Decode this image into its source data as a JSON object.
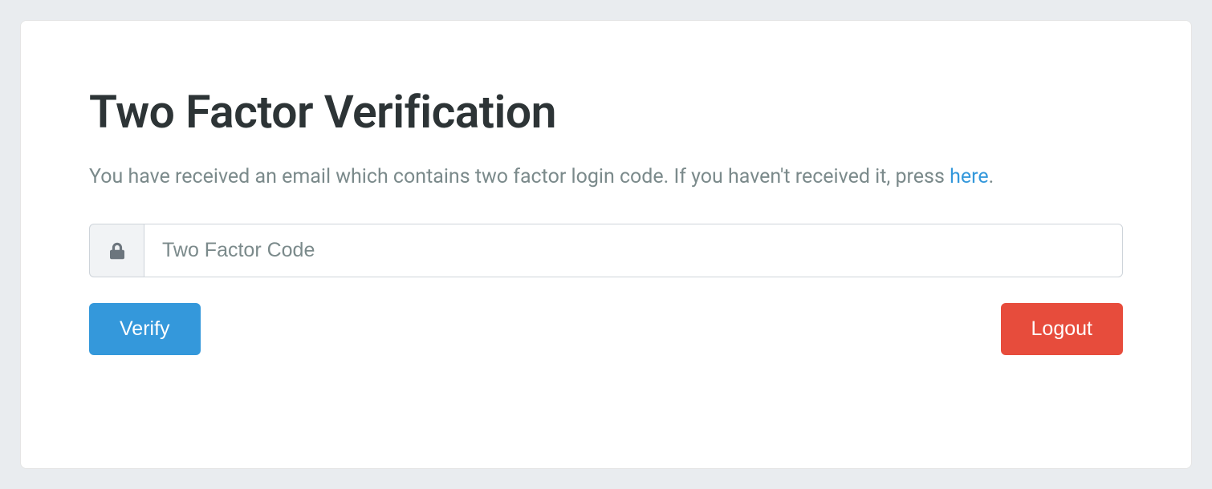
{
  "card": {
    "title": "Two Factor Verification",
    "description_prefix": "You have received an email which contains two factor login code. If you haven't received it, press ",
    "description_link": "here",
    "description_suffix": "."
  },
  "form": {
    "code_placeholder": "Two Factor Code",
    "code_value": ""
  },
  "buttons": {
    "verify": "Verify",
    "logout": "Logout"
  }
}
